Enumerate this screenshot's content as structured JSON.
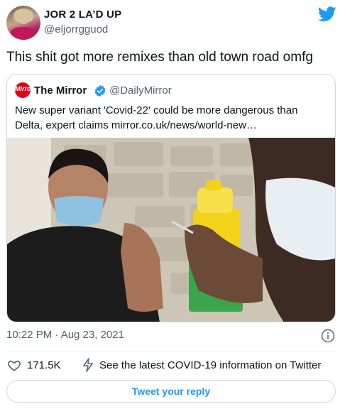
{
  "author": {
    "name": "JOR 2 LA’D UP",
    "handle": "@eljorrgguod"
  },
  "tweet_text": "This shit got more remixes than old town road omfg",
  "quoted": {
    "avatar_text": "Mirror",
    "name": "The Mirror",
    "handle": "@DailyMirror",
    "text": "New super variant 'Covid-22' could be more dangerous than Delta, expert claims mirror.co.uk/news/world-new…"
  },
  "timestamp": "10:22 PM · Aug 23, 2021",
  "likes": "171.5K",
  "covid_link": "See the latest COVID-19 information on Twitter",
  "reply_button": "Tweet your reply",
  "colors": {
    "accent": "#1d9bf0",
    "muted": "#536471",
    "border": "#cfd9de",
    "mirror_red": "#e2001a"
  },
  "icons": [
    "twitter-logo-icon",
    "verified-badge-icon",
    "info-icon",
    "heart-icon",
    "bolt-icon"
  ]
}
